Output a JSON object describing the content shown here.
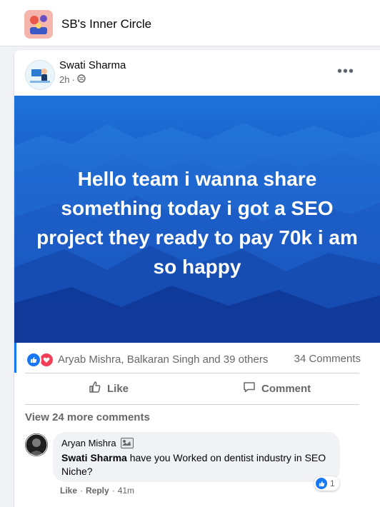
{
  "group": {
    "name": "SB's Inner Circle"
  },
  "post": {
    "author": "Swati Sharma",
    "time": "2h",
    "separator": "·",
    "more_label": "•••",
    "banner_text": "Hello team i wanna share something today i got a SEO project they ready to pay 70k i am so happy",
    "reactions_text": "Aryab Mishra, Balkaran Singh and 39 others",
    "comments_count": "34 Comments",
    "actions": {
      "like_label": "Like",
      "comment_label": "Comment"
    },
    "view_more": "View 24 more comments"
  },
  "comment": {
    "author": "Aryan Mishra",
    "mention": "Swati Sharma",
    "text": " have you Worked on dentist industry in SEO Niche?",
    "reaction_count": "1",
    "like_label": "Like",
    "reply_label": "Reply",
    "separator": "·",
    "time": "41m"
  },
  "colors": {
    "accent": "#1877f2",
    "love": "#f33e58",
    "muted_text": "#65676b",
    "banner_top": "#1e73d8",
    "banner_bottom": "#0d2d8e"
  },
  "icons": [
    "group-icon",
    "author-avatar",
    "globe-icon",
    "more-icon",
    "like-reaction-icon",
    "love-reaction-icon",
    "thumbs-up-icon",
    "comment-icon",
    "badge-icon"
  ]
}
